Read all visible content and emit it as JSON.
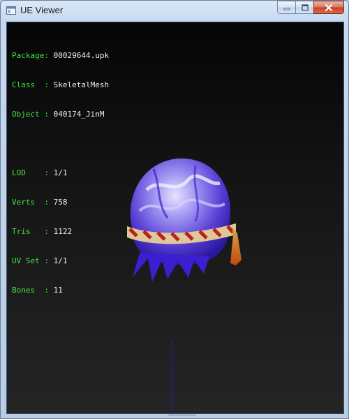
{
  "window": {
    "title": "UE Viewer",
    "icons": {
      "app": "app-window-icon",
      "minimize": "minimize-icon",
      "maximize": "maximize-icon",
      "close": "close-icon"
    }
  },
  "info": {
    "package_label": "Package:",
    "package_value": "00029644.upk",
    "class_label": "Class  :",
    "class_value": "SkeletalMesh",
    "object_label": "Object :",
    "object_value": "040174_JinM",
    "lod_label": "LOD    :",
    "lod_value": "1/1",
    "verts_label": "Verts  :",
    "verts_value": "758",
    "tris_label": "Tris   :",
    "tris_value": "1122",
    "uvset_label": "UV Set :",
    "uvset_value": "1/1",
    "bones_label": "Bones  :",
    "bones_value": "11"
  },
  "colors": {
    "label": "#3de43d",
    "value": "#f0f0f0",
    "axis": "#2020d0",
    "mesh_primary": "#7c6ee8",
    "mesh_highlight": "#e8e4ff",
    "band_red": "#b8221a",
    "band_gold": "#e0c79a"
  }
}
